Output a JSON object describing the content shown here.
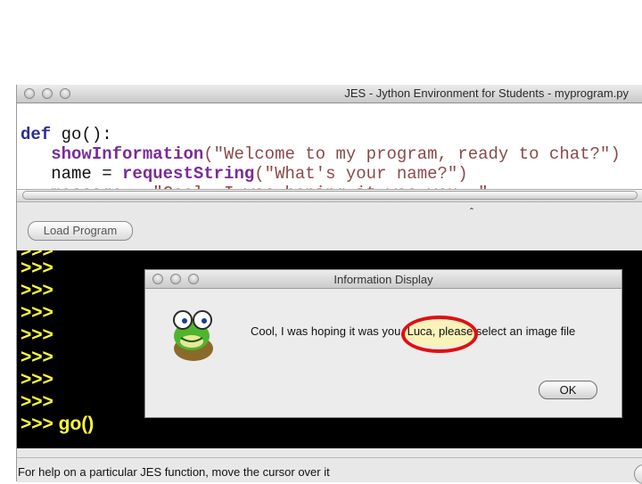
{
  "window": {
    "title": "JES - Jython Environment for Students - myprogram.py"
  },
  "editor": {
    "line_def_keyword": "def",
    "line_def_rest": " go():",
    "line2_indent": "   ",
    "line2_func": "showInformation",
    "line2_args": "(\"Welcome to my program, ready to chat?\")",
    "line3_lhs": "   name = ",
    "line3_func": "requestString",
    "line3_args": "(\"What's your name?\")",
    "line4_partial": "   message = \"Cool, I was hoping it was you, \""
  },
  "toolbar": {
    "load_button_label": "Load Program"
  },
  "console": {
    "prompts": [
      ">>>",
      ">>>",
      ">>>",
      ">>>",
      ">>>",
      ">>>",
      ">>>"
    ],
    "last_line": ">>> go()"
  },
  "status_bar": {
    "text": "For help on a particular JES function, move the cursor over it"
  },
  "dialog": {
    "title": "Information Display",
    "message": "Cool, I was hoping it was you, Luca, please select an image file",
    "ok_label": "OK",
    "icon": "jes-frog-icon"
  },
  "colors": {
    "console_background": "#000000",
    "prompt_color": "#ffff33",
    "keyword_color": "#2d2d8f",
    "function_color": "#7a2a9a",
    "string_color": "#8a4a4a",
    "annotation_ring": "#e01010"
  }
}
